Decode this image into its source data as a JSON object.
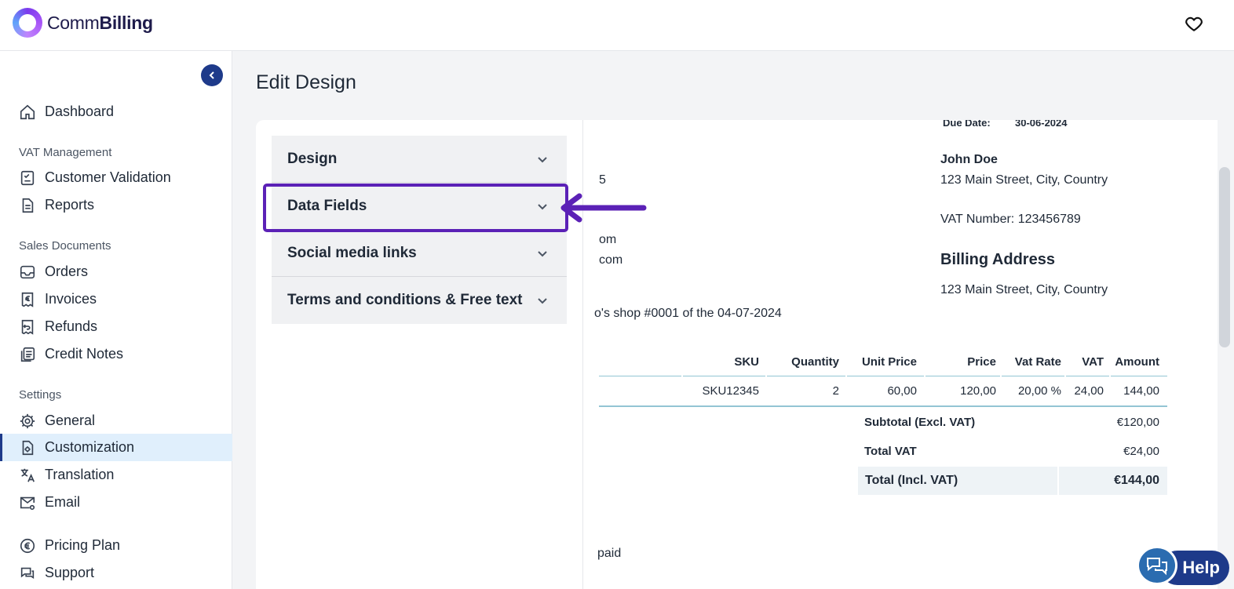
{
  "brand": {
    "name_regular": "Comm",
    "name_bold": "Billing"
  },
  "sidebar": {
    "items": [
      {
        "label": "Dashboard",
        "icon": "home-icon"
      },
      {
        "label": "Customer Validation",
        "icon": "validation-icon"
      },
      {
        "label": "Reports",
        "icon": "document-icon"
      },
      {
        "label": "Orders",
        "icon": "inbox-icon"
      },
      {
        "label": "Invoices",
        "icon": "euro-receipt-icon"
      },
      {
        "label": "Refunds",
        "icon": "refund-icon"
      },
      {
        "label": "Credit Notes",
        "icon": "notes-icon"
      },
      {
        "label": "General",
        "icon": "gear-icon"
      },
      {
        "label": "Customization",
        "icon": "customize-file-icon",
        "active": true
      },
      {
        "label": "Translation",
        "icon": "translate-icon"
      },
      {
        "label": "Email",
        "icon": "mail-gear-icon"
      },
      {
        "label": "Pricing Plan",
        "icon": "euro-circle-icon"
      },
      {
        "label": "Support",
        "icon": "chat-icon"
      }
    ],
    "sections": [
      "VAT Management",
      "Sales Documents",
      "Settings"
    ]
  },
  "main": {
    "title": "Edit Design",
    "accordion": [
      "Design",
      "Data Fields",
      "Social media links",
      "Terms and conditions & Free text"
    ]
  },
  "preview": {
    "due_label": "Due Date:",
    "due_value": "30-06-2024",
    "customer_name": "John Doe",
    "customer_address": "123 Main Street, City, Country",
    "vat_number": "VAT Number: 123456789",
    "billing_title": "Billing Address",
    "billing_address": "123 Main Street, City, Country",
    "left_frag_1": "5",
    "left_frag_2": "om",
    "left_frag_3": "com",
    "order_ref": "o's shop #0001 of the 04-07-2024",
    "left_frag_paid": "paid",
    "table": {
      "headers": [
        "SKU",
        "Quantity",
        "Unit Price",
        "Price",
        "Vat Rate",
        "VAT",
        "Amount"
      ],
      "row": [
        "SKU12345",
        "2",
        "60,00",
        "120,00",
        "20,00 %",
        "24,00",
        "144,00"
      ]
    },
    "totals": {
      "subtotal_label": "Subtotal (Excl. VAT)",
      "subtotal_value": "€120,00",
      "vat_label": "Total VAT",
      "vat_value": "€24,00",
      "total_label": "Total (Incl. VAT)",
      "total_value": "€144,00"
    }
  },
  "help": {
    "label": "Help"
  },
  "colors": {
    "accent": "#1e3a8a",
    "highlight": "#5b21b6",
    "active_bg": "#e0effc"
  }
}
